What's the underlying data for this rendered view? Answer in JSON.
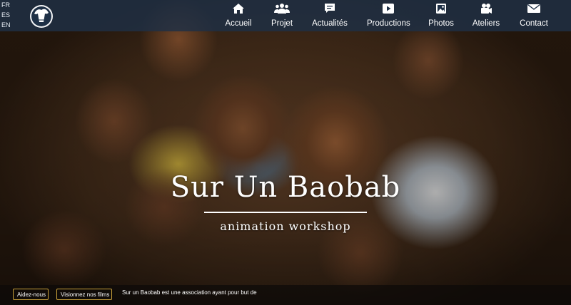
{
  "languages": [
    "FR",
    "ES",
    "EN"
  ],
  "nav": {
    "items": [
      {
        "label": "Accueil",
        "icon": "home-icon"
      },
      {
        "label": "Projet",
        "icon": "users-icon"
      },
      {
        "label": "Actualités",
        "icon": "comment-icon"
      },
      {
        "label": "Productions",
        "icon": "play-icon"
      },
      {
        "label": "Photos",
        "icon": "image-icon"
      },
      {
        "label": "Ateliers",
        "icon": "camera-icon"
      },
      {
        "label": "Contact",
        "icon": "envelope-icon"
      }
    ]
  },
  "hero": {
    "title": "Sur Un Baobab",
    "subtitle": "animation workshop"
  },
  "footer": {
    "help_label": "Aidez-nous",
    "films_label": "Visionnez nos films",
    "tagline": "Sur un Baobab est une association ayant pour but de"
  },
  "colors": {
    "nav_bg": "#1e3046",
    "button_border": "#c9a13a",
    "text": "#ffffff"
  }
}
